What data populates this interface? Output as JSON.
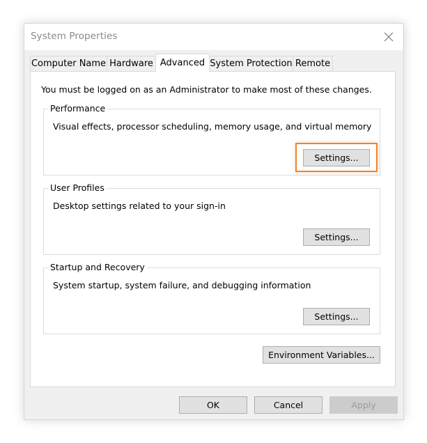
{
  "window": {
    "title": "System Properties"
  },
  "tabs": [
    {
      "label": "Computer Name",
      "active": false
    },
    {
      "label": "Hardware",
      "active": false
    },
    {
      "label": "Advanced",
      "active": true
    },
    {
      "label": "System Protection",
      "active": false
    },
    {
      "label": "Remote",
      "active": false
    }
  ],
  "advanced": {
    "notice": "You must be logged on as an Administrator to make most of these changes.",
    "performance": {
      "label": "Performance",
      "description": "Visual effects, processor scheduling, memory usage, and virtual memory",
      "button": "Settings..."
    },
    "user_profiles": {
      "label": "User Profiles",
      "description": "Desktop settings related to your sign-in",
      "button": "Settings..."
    },
    "startup_recovery": {
      "label": "Startup and Recovery",
      "description": "System startup, system failure, and debugging information",
      "button": "Settings..."
    },
    "env_button": "Environment Variables..."
  },
  "footer": {
    "ok": "OK",
    "cancel": "Cancel",
    "apply": "Apply"
  },
  "colors": {
    "highlight": "#f0832b",
    "window_bg": "#f0f0f0",
    "button_bg": "#e1e1e1"
  },
  "icons": {
    "close": "close-icon"
  }
}
